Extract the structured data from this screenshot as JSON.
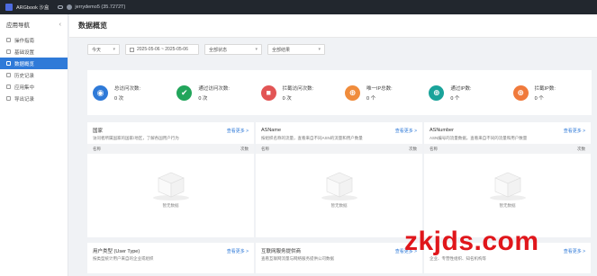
{
  "topbar": {
    "app_title": "ARGbook 沙盒",
    "user_text": "jerrydemo5 (35.7272T)"
  },
  "sidebar": {
    "title": "应用导航",
    "items": [
      {
        "label": "操作指南",
        "active": false
      },
      {
        "label": "基础设置",
        "active": false
      },
      {
        "label": "数据概览",
        "active": true
      },
      {
        "label": "历史记录",
        "active": false
      },
      {
        "label": "应用集中",
        "active": false
      },
      {
        "label": "导出记录",
        "active": false
      }
    ]
  },
  "page": {
    "title": "数据概览"
  },
  "filters": {
    "period": "今天",
    "date_range": "2025-05-06 ~ 2025-05-06",
    "type": "全部状态",
    "result": "全部结果"
  },
  "stats": [
    {
      "icon": "eye-icon",
      "color": "#2f7ad8",
      "glyph": "◉",
      "label": "总访问次数:",
      "value": "0 次"
    },
    {
      "icon": "user-check-icon",
      "color": "#22a55b",
      "glyph": "✔",
      "label": "通过访问次数:",
      "value": "0 次"
    },
    {
      "icon": "shield-block-icon",
      "color": "#e25555",
      "glyph": "■",
      "label": "拦截访问次数:",
      "value": "0 次"
    },
    {
      "icon": "globe-icon",
      "color": "#f08c3c",
      "glyph": "⊕",
      "label": "唯一IP总数:",
      "value": "0 个"
    },
    {
      "icon": "globe-pass-icon",
      "color": "#1aa39a",
      "glyph": "⊕",
      "label": "通过IP数:",
      "value": "0 个"
    },
    {
      "icon": "globe-block-icon",
      "color": "#f07a3c",
      "glyph": "⊕",
      "label": "拦截IP数:",
      "value": "0 个"
    }
  ],
  "cards": [
    {
      "title": "国家",
      "more": "查看更多 >",
      "desc": "访问者所属国家的国家/地区，了解各国用户行为",
      "col_name": "名称",
      "col_count": "次数",
      "empty": "暂无数据"
    },
    {
      "title": "ASName",
      "more": "查看更多 >",
      "desc": "按组织名称的流量，查看来自不同ASN的流量和用户数量",
      "col_name": "名称",
      "col_count": "次数",
      "empty": "暂无数据"
    },
    {
      "title": "ASNumber",
      "more": "查看更多 >",
      "desc": "ASN编号的流量数据，查看来自不同的流量和用户数量",
      "col_name": "名称",
      "col_count": "次数",
      "empty": "暂无数据"
    },
    {
      "title": "用户类型 (User Type)",
      "more": "查看更多 >",
      "desc": "按类型统计用户来自的企业或组织"
    },
    {
      "title": "互联网服务提供商",
      "more": "查看更多 >",
      "desc": "查看互联网流量与网络服务提供公司数据"
    },
    {
      "title": "",
      "more": "查看更多 >",
      "desc": "企业、专营性组织、知名机构等"
    }
  ],
  "watermark": "zkjds.com"
}
